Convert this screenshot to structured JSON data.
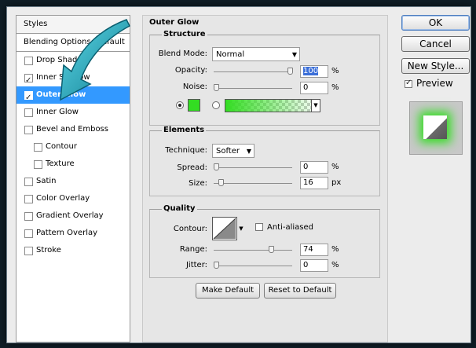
{
  "left_panel": {
    "header": "Styles",
    "blending_options": "Blending Options: Default",
    "items": [
      {
        "label": "Drop Shadow",
        "checked": false
      },
      {
        "label": "Inner Shadow",
        "checked": true
      },
      {
        "label": "Outer Glow",
        "checked": true,
        "selected": true
      },
      {
        "label": "Inner Glow",
        "checked": false
      },
      {
        "label": "Bevel and Emboss",
        "checked": false
      },
      {
        "label": "Contour",
        "checked": false,
        "indent": true
      },
      {
        "label": "Texture",
        "checked": false,
        "indent": true
      },
      {
        "label": "Satin",
        "checked": false
      },
      {
        "label": "Color Overlay",
        "checked": false
      },
      {
        "label": "Gradient Overlay",
        "checked": false
      },
      {
        "label": "Pattern Overlay",
        "checked": false
      },
      {
        "label": "Stroke",
        "checked": false
      }
    ]
  },
  "outer_glow": {
    "title": "Outer Glow",
    "structure": {
      "title": "Structure",
      "blend_mode_label": "Blend Mode:",
      "blend_mode_value": "Normal",
      "opacity_label": "Opacity:",
      "opacity_value": "100",
      "opacity_unit": "%",
      "opacity_level": 1.0,
      "noise_label": "Noise:",
      "noise_value": "0",
      "noise_unit": "%",
      "noise_level": 0.0,
      "color_swatch": "#33dd22",
      "color_mode_selected": "solid"
    },
    "elements": {
      "title": "Elements",
      "technique_label": "Technique:",
      "technique_value": "Softer",
      "spread_label": "Spread:",
      "spread_value": "0",
      "spread_unit": "%",
      "spread_level": 0.0,
      "size_label": "Size:",
      "size_value": "16",
      "size_unit": "px",
      "size_level": 0.064
    },
    "quality": {
      "title": "Quality",
      "contour_label": "Contour:",
      "anti_aliased_label": "Anti-aliased",
      "anti_aliased": false,
      "range_label": "Range:",
      "range_value": "74",
      "range_unit": "%",
      "range_level": 0.74,
      "jitter_label": "Jitter:",
      "jitter_value": "0",
      "jitter_unit": "%",
      "jitter_level": 0.0
    },
    "make_default": "Make Default",
    "reset_default": "Reset to Default"
  },
  "buttons": {
    "ok": "OK",
    "cancel": "Cancel",
    "new_style": "New Style...",
    "preview_label": "Preview",
    "preview_checked": true
  },
  "colors": {
    "selection": "#3399ff",
    "glow": "#33dd22",
    "arrow": "#1aa6b5"
  }
}
